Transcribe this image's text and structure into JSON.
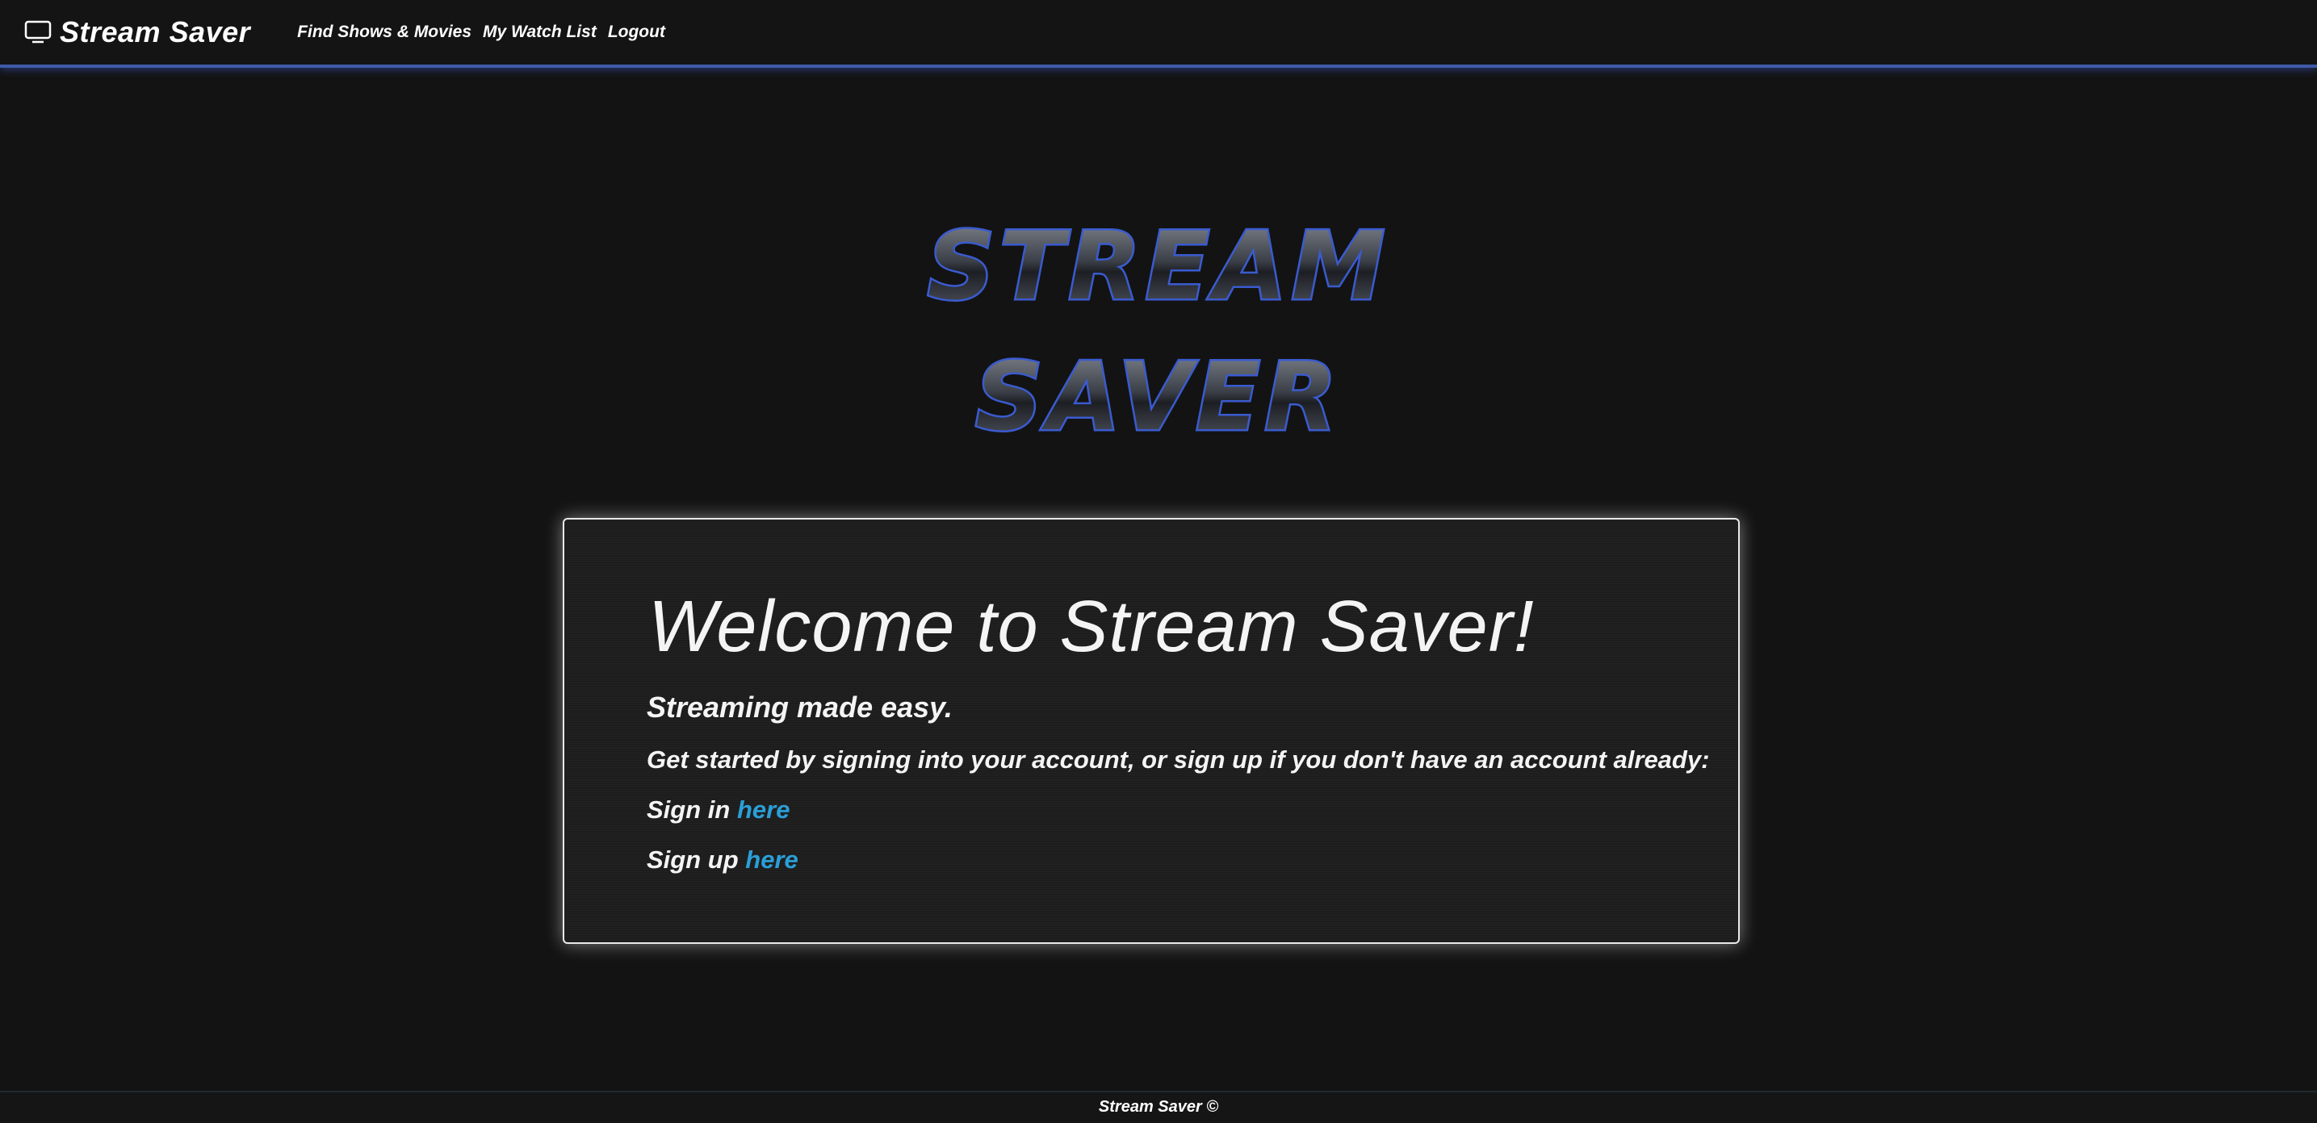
{
  "navbar": {
    "brand_icon": "tv-icon",
    "brand_name": "Stream Saver",
    "links": [
      "Find Shows & Movies",
      "My Watch List",
      "Logout"
    ]
  },
  "logo": {
    "line1": "STREAM",
    "line2": "SAVER",
    "color": "#3a5bd0"
  },
  "welcome": {
    "title": "Welcome to Stream Saver!",
    "tagline": "Streaming made easy.",
    "intro": "Get started by signing into your account, or sign up if you don't have an account already:",
    "signin_label": "Sign in",
    "signin_link": "here",
    "signup_label": "Sign up",
    "signup_link": "here"
  },
  "footer": {
    "text": "Stream Saver ©"
  },
  "colors": {
    "background": "#131313",
    "accent_blue": "#3f5aa8",
    "link": "#2a9fd8"
  }
}
